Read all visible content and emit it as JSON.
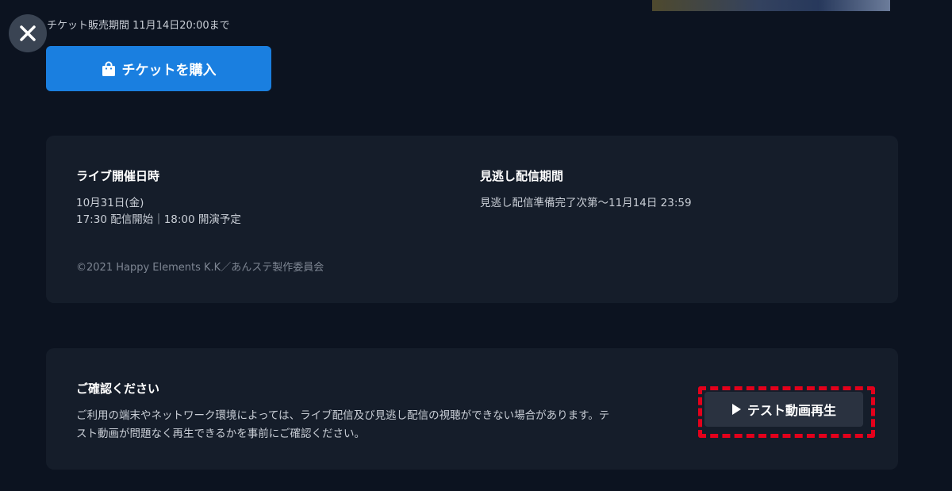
{
  "header": {
    "close_icon": "close-icon",
    "sale_period": "チケット販売期間 11月14日20:00まで"
  },
  "buy": {
    "icon": "shopping-bag-icon",
    "label": "チケットを購入",
    "color": "#1a7fe0"
  },
  "info": {
    "live": {
      "title": "ライブ開催日時",
      "date": "10月31日(金)",
      "time": "17:30 配信開始｜18:00 開演予定"
    },
    "archive": {
      "title": "見逃し配信期間",
      "period": "見逃し配信準備完了次第〜11月14日 23:59"
    },
    "copyright": "©2021 Happy Elements K.K／あんステ製作委員会"
  },
  "confirm": {
    "title": "ご確認ください",
    "line1": "ご利用の端末やネットワーク環境によっては、ライブ配信及び見逃し配信の視聴ができない場合があります。テ",
    "line2": "スト動画が問題なく再生できるかを事前にご確認ください。",
    "button_icon": "play-icon",
    "button_label": "テスト動画再生",
    "highlight_color": "#e3001b"
  }
}
